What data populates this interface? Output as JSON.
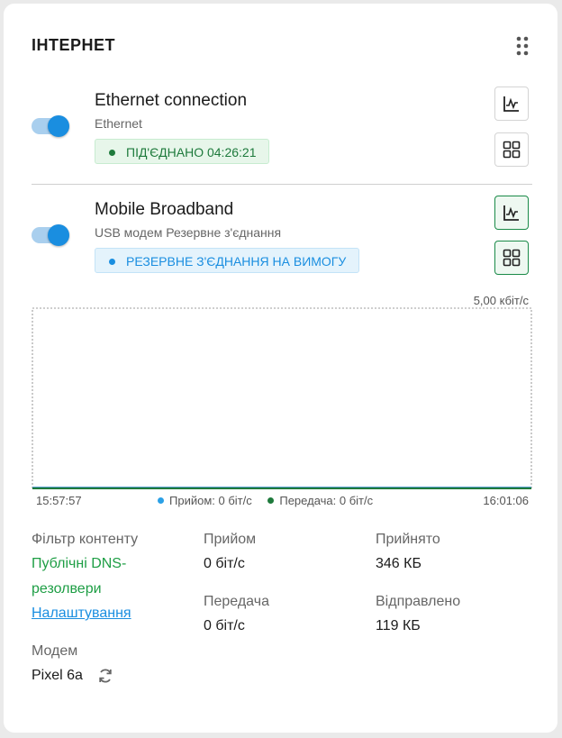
{
  "header": {
    "title": "ІНТЕРНЕТ",
    "menu_icon": "kebab-grid-icon"
  },
  "connections": [
    {
      "name": "Ethernet connection",
      "subtitle": "Ethernet",
      "enabled": true,
      "status": "ПІД'ЄДНАНО 04:26:21",
      "status_color": "#1e7a3c",
      "chart_button_active": false,
      "apps_button_active": false
    },
    {
      "name": "Mobile Broadband",
      "subtitle": "USB модем Резервне з'єднання",
      "enabled": true,
      "status": "РЕЗЕРВНЕ З'ЄДНАННЯ НА ВИМОГУ",
      "status_color": "#1a8ee0",
      "chart_button_active": true,
      "apps_button_active": true
    }
  ],
  "chart_data": {
    "type": "line",
    "max_label": "5,00 кбіт/с",
    "x_start": "15:57:57",
    "x_end": "16:01:06",
    "ylim": [
      0,
      5.0
    ],
    "series": [
      {
        "name": "Прийом",
        "label": "Прийом: 0 біт/с",
        "color": "#2ba0e6",
        "values": [
          0,
          0
        ]
      },
      {
        "name": "Передача",
        "label": "Передача: 0 біт/с",
        "color": "#1e7a3c",
        "values": [
          0,
          0
        ]
      }
    ]
  },
  "stats": {
    "filter_label": "Фільтр контенту",
    "filter_value_line1": "Публічні DNS-",
    "filter_value_line2": "резолвери",
    "filter_link": "Налаштування",
    "rx_label": "Прийом",
    "rx_value": "0 біт/с",
    "tx_label": "Передача",
    "tx_value": "0 біт/с",
    "received_label": "Прийнято",
    "received_value": "346 КБ",
    "sent_label": "Відправлено",
    "sent_value": "119 КБ",
    "modem_label": "Модем",
    "modem_value": "Pixel 6a",
    "modem_icon": "refresh-icon"
  },
  "colors": {
    "accent": "#1a8ee0",
    "success": "#1e7a3c",
    "card": "#ffffff"
  }
}
